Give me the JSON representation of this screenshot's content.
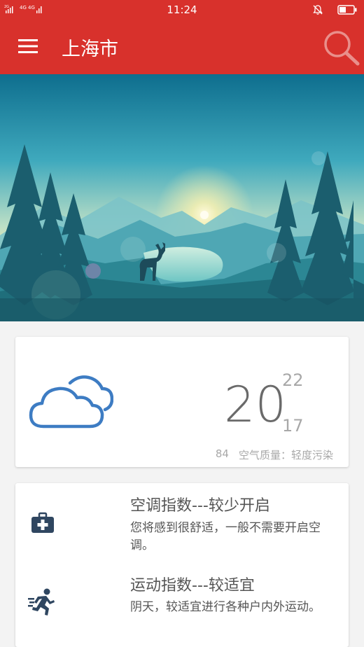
{
  "status_bar": {
    "signal_text": "2G 4G 4G",
    "time": "11:24",
    "icons": [
      "signal-icon",
      "bell-muted-icon",
      "battery-icon"
    ]
  },
  "app_bar": {
    "title": "上海市",
    "icons": [
      "menu-icon",
      "search-icon"
    ]
  },
  "hero": {
    "image_description_icon": "landscape-illustration"
  },
  "weather": {
    "icon": "cloud-icon",
    "temp_now": "20",
    "temp_high": "22",
    "temp_low": "17",
    "aqi_value": "84",
    "aqi_text": "空气质量：轻度污染"
  },
  "indices": [
    {
      "icon": "medical-kit-icon",
      "title": "空调指数---较少开启",
      "desc": "您将感到很舒适，一般不需要开启空调。"
    },
    {
      "icon": "running-icon",
      "title": "运动指数---较适宜",
      "desc": "阴天，较适宜进行各种户内外运动。"
    }
  ],
  "colors": {
    "primary": "#d8312c",
    "icon_dark": "#2f4660",
    "cloud_blue": "#3d7cc3"
  }
}
